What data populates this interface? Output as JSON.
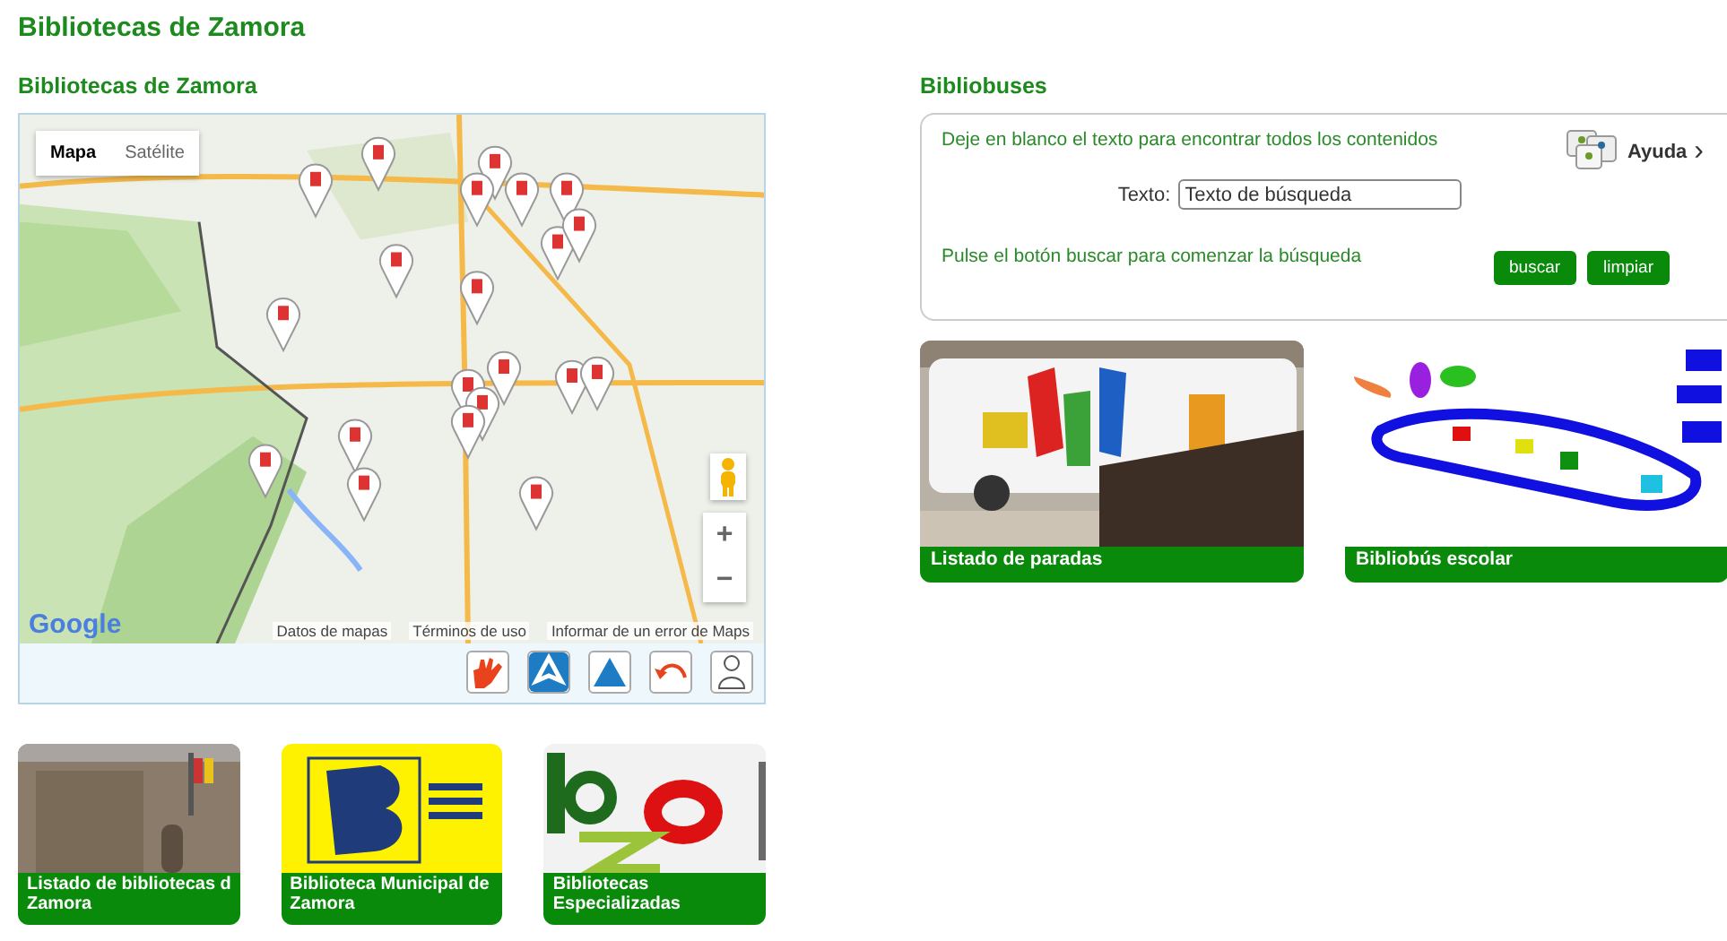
{
  "page_title": "Bibliotecas de Zamora",
  "map_section": {
    "heading": "Bibliotecas de Zamora",
    "map": {
      "kind": "picture",
      "type_buttons": [
        {
          "label": "Mapa",
          "selected": true
        },
        {
          "label": "Satélite",
          "selected": false
        }
      ],
      "zoom_in": "+",
      "zoom_out": "−",
      "logo": "Google",
      "attribution": [
        "Datos de mapas",
        "Términos de uso",
        "Informar de un error de Maps"
      ]
    },
    "tools": [
      {
        "kind": "hand"
      },
      {
        "kind": "compass"
      },
      {
        "kind": "triangle"
      },
      {
        "kind": "undo"
      },
      {
        "kind": "figure"
      }
    ]
  },
  "library_cards": [
    {
      "caption_lines": [
        "Listado de bibliotecas d",
        "Zamora"
      ],
      "kind": "stone"
    },
    {
      "caption_lines": [
        "Biblioteca Municipal de",
        "Zamora"
      ],
      "kind": "yellow"
    },
    {
      "caption_lines": [
        "Bibliotecas",
        "Especializadas"
      ],
      "kind": "letters"
    }
  ],
  "bus_section": {
    "heading": "Bibliobuses",
    "search": {
      "hint": "Deje en blanco el texto para encontrar todos los contenidos",
      "help": "Ayuda",
      "help_caret": "›",
      "field_label": "Texto:",
      "placeholder": "Texto de búsqueda",
      "instruction": "Pulse el botón buscar para comenzar la búsqueda",
      "buttons": [
        "buscar",
        "limpiar"
      ]
    },
    "cards": [
      {
        "caption": "Listado de paradas",
        "kind": "bus"
      },
      {
        "caption": "Bibliobús escolar",
        "kind": "drawing"
      }
    ]
  }
}
